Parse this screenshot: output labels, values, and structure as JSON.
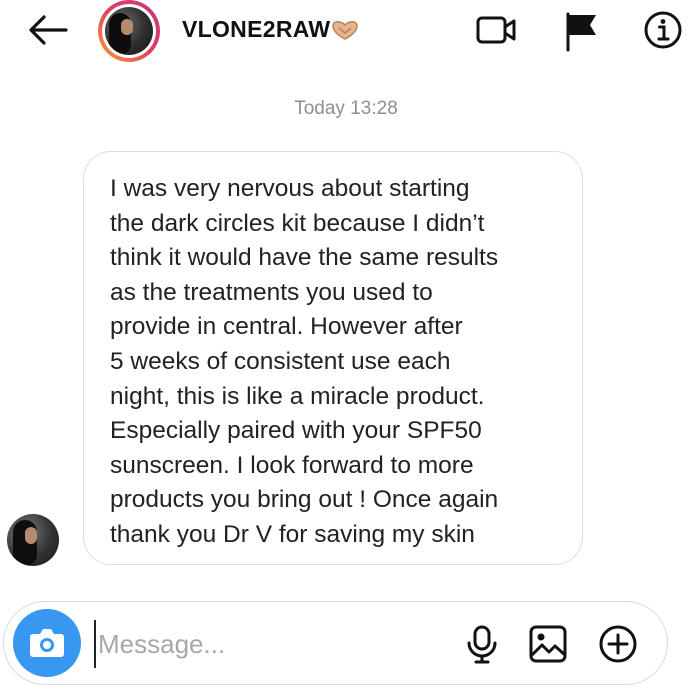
{
  "header": {
    "username": "VLONE2RAW",
    "icons": [
      "back-arrow-icon",
      "heart-hands-icon",
      "video-call-icon",
      "flag-icon",
      "info-icon"
    ]
  },
  "thread": {
    "timestamp": "Today 13:28",
    "messages": [
      {
        "text": "I was very nervous about starting\nthe dark circles kit because I didn’t\nthink it would have the same results\nas the treatments you used to\nprovide in central. However after\n5 weeks of consistent use each\nnight, this is like a miracle product.\nEspecially paired with your SPF50\nsunscreen. I look forward to more\nproducts you bring out ! Once again\nthank you Dr V for saving my skin"
      }
    ]
  },
  "composer": {
    "placeholder": "Message...",
    "value": "",
    "icons": [
      "camera-icon",
      "microphone-icon",
      "gallery-icon",
      "add-icon"
    ]
  },
  "colors": {
    "accent": "#3897f0",
    "timestamp": "#8e8e8e",
    "bubble_border": "#dedede"
  }
}
